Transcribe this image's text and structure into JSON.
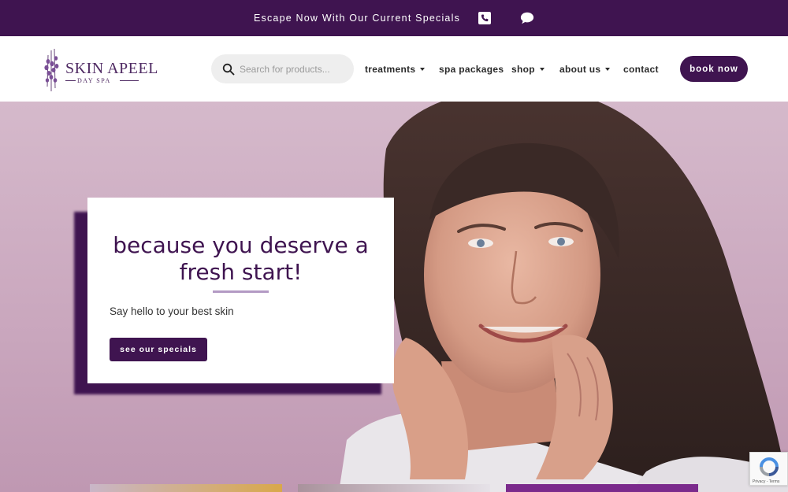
{
  "topbar": {
    "promo_text": "Escape Now With Our Current Specials",
    "icons": [
      "phone-icon",
      "sms-icon"
    ],
    "sms_label": "SMS"
  },
  "header": {
    "logo": {
      "brand": "SKIN APEEL",
      "sub": "DAY SPA"
    },
    "search": {
      "placeholder": "Search for products..."
    },
    "nav": [
      {
        "label": "treatments",
        "has_dropdown": true
      },
      {
        "label": "spa packages",
        "has_dropdown": false
      },
      {
        "label": "shop",
        "has_dropdown": true
      },
      {
        "label": "about us",
        "has_dropdown": true
      },
      {
        "label": "contact",
        "has_dropdown": false
      }
    ],
    "book_label": "book now"
  },
  "hero": {
    "headline": "because you deserve a fresh start!",
    "subtitle": "Say hello to your best skin",
    "cta_label": "see our specials"
  },
  "recaptcha": {
    "text": "Privacy - Terms"
  },
  "colors": {
    "brand_purple": "#3f1450",
    "hero_bg": "#d5b9cb",
    "divider": "#b39ac4"
  }
}
